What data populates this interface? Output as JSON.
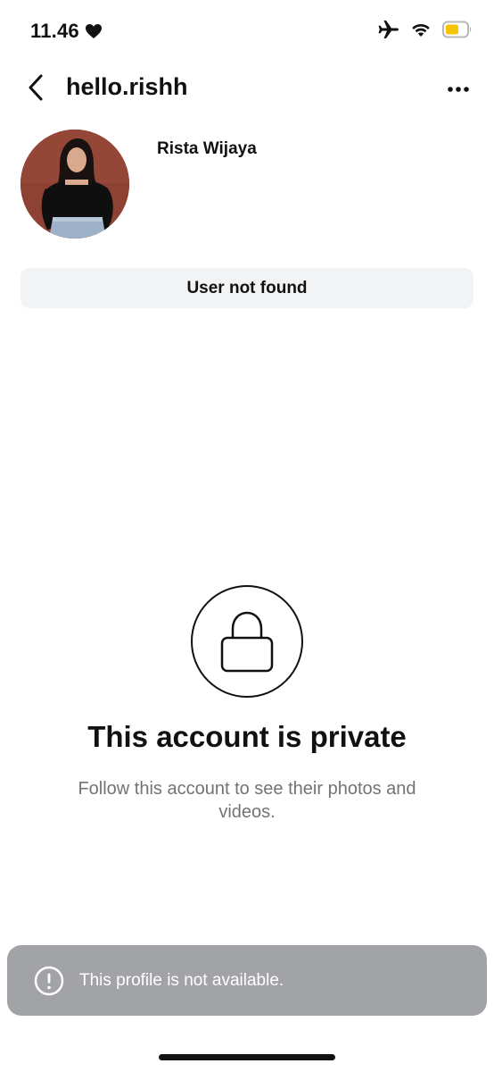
{
  "status_bar": {
    "time": "11.46",
    "icons": [
      "heart-icon",
      "airplane-icon",
      "wifi-icon",
      "battery-icon"
    ],
    "battery_color": "#f5c400"
  },
  "header": {
    "username": "hello.rishh",
    "icons": [
      "back-arrow-icon",
      "more-options-icon"
    ]
  },
  "profile": {
    "display_name": "Rista Wijaya",
    "status_label": "User not found"
  },
  "private_notice": {
    "icon": "lock-icon",
    "title": "This account is private",
    "description": "Follow this account to see their photos and videos."
  },
  "toast": {
    "icon": "exclamation-circle-icon",
    "message": "This profile is not available."
  },
  "colors": {
    "text": "#111111",
    "secondary_text": "#737373",
    "pill_bg": "#f2f3f5",
    "toast_bg": "#a2a3a7"
  }
}
